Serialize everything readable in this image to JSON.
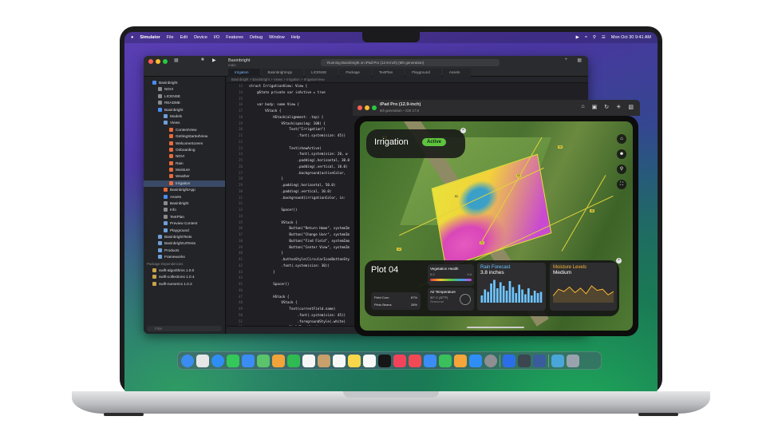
{
  "menubar": {
    "items": [
      "Simulator",
      "File",
      "Edit",
      "Device",
      "I/O",
      "Features",
      "Debug",
      "Window",
      "Help"
    ],
    "clock": "Mon Oct 30 9:41 AM"
  },
  "xcode": {
    "project": "Basinbright",
    "project_sub": "main",
    "status": "Running Basinbright on iPad Pro (12.9-inch) (6th generation)",
    "tabs": [
      "Irrigation",
      "BasinbrightApp",
      "LICENSE",
      "Package",
      "TextPlan",
      "Playground",
      "Assets"
    ],
    "nav": [
      {
        "label": "Basinbright",
        "indent": 1,
        "color": "#4a8cf0"
      },
      {
        "label": "NDVI",
        "indent": 2,
        "color": "#8a8a8a"
      },
      {
        "label": "LICENSE",
        "indent": 2,
        "color": "#8a8a8a"
      },
      {
        "label": "README",
        "indent": 2,
        "color": "#8a8a8a"
      },
      {
        "label": "Basinbright",
        "indent": 2,
        "color": "#4a8cf0"
      },
      {
        "label": "Models",
        "indent": 3,
        "color": "#6e9fd8"
      },
      {
        "label": "Views",
        "indent": 3,
        "color": "#6e9fd8"
      },
      {
        "label": "ContentView",
        "indent": 4,
        "color": "#e86a3a"
      },
      {
        "label": "GettingStartedView",
        "indent": 4,
        "color": "#e86a3a"
      },
      {
        "label": "WelcomeScreen",
        "indent": 4,
        "color": "#e86a3a"
      },
      {
        "label": "Onboarding",
        "indent": 4,
        "color": "#e86a3a"
      },
      {
        "label": "NDVI",
        "indent": 4,
        "color": "#e86a3a"
      },
      {
        "label": "Rain",
        "indent": 4,
        "color": "#e86a3a"
      },
      {
        "label": "Moisture",
        "indent": 4,
        "color": "#e86a3a"
      },
      {
        "label": "Weather",
        "indent": 4,
        "color": "#e86a3a"
      },
      {
        "label": "Irrigation",
        "indent": 4,
        "color": "#e86a3a",
        "selected": true
      },
      {
        "label": "BasinbrightApp",
        "indent": 3,
        "color": "#e86a3a"
      },
      {
        "label": "Assets",
        "indent": 3,
        "color": "#4a8cf0"
      },
      {
        "label": "Basinbright",
        "indent": 3,
        "color": "#8a8a8a"
      },
      {
        "label": "Info",
        "indent": 3,
        "color": "#8a8a8a"
      },
      {
        "label": "TestPlan",
        "indent": 3,
        "color": "#8a8a8a"
      },
      {
        "label": "Preview Content",
        "indent": 3,
        "color": "#6e9fd8"
      },
      {
        "label": "Playground",
        "indent": 3,
        "color": "#6e9fd8"
      },
      {
        "label": "BasinbrightTests",
        "indent": 2,
        "color": "#6e9fd8"
      },
      {
        "label": "BasinbrightUITests",
        "indent": 2,
        "color": "#6e9fd8"
      },
      {
        "label": "Products",
        "indent": 2,
        "color": "#6e9fd8"
      },
      {
        "label": "Frameworks",
        "indent": 2,
        "color": "#6e9fd8"
      }
    ],
    "pkg_header": "Package Dependencies",
    "packages": [
      {
        "label": "swift-algorithms 1.0.0"
      },
      {
        "label": "swift-collections 1.0.4"
      },
      {
        "label": "swift-numerics 1.0.2"
      }
    ],
    "filter": "Filter",
    "line_numbers": [
      "13",
      "14",
      "15",
      "16",
      "17",
      "18",
      "19",
      "20",
      "21",
      "22",
      "23",
      "24",
      "25",
      "26",
      "27",
      "28",
      "29",
      "30",
      "31",
      "32",
      "33",
      "34",
      "35",
      "36",
      "37",
      "38",
      "39",
      "40",
      "41",
      "42",
      "43",
      "44",
      "45",
      "46",
      "47",
      "48",
      "49",
      "50",
      "51",
      "52",
      "53",
      "54",
      "55",
      "56"
    ],
    "code": [
      "struct IrrigationView: View {",
      "    @State private var isActive = true",
      "",
      "    var body: some View {",
      "        VStack {",
      "            HStack(alignment: .top) {",
      "                VStack(spacing: 100) {",
      "                    Text(\"Irrigation\")",
      "                        .font(.system(size: 45))",
      "",
      "                    Text(showActive)",
      "                        .font(.system(size: 20, w",
      "                        .padding(.horizontal, 30.0",
      "                        .padding(.vertical, 10.0)",
      "                        .background(activeColor,",
      "                }",
      "                .padding(.horizontal, 50.0)",
      "                .padding(.vertical, 10.0)",
      "                .background(irrigationColor, in:",
      "",
      "                Spacer()",
      "",
      "                VStack {",
      "                    Button(\"Return Home\", systemIm",
      "                    Button(\"Change User\", systemIm",
      "                    Button(\"Find Field\", systemImo",
      "                    Button(\"Center View\", systemIm",
      "                }",
      "                .buttonStyle(CircularIconButtonSty",
      "                .font(.system(size: 30))",
      "            }",
      "",
      "            Spacer()",
      "",
      "            HStack {",
      "                VStack {",
      "                    Text(currentField.name)",
      "                        .font(.system(size: 45))",
      "                        .foregroundStyle(.white)",
      "                    FieldTypeView()",
      "                }",
      "                VStack {",
      "                    HealthView()",
      "                    TemperatureView()"
    ],
    "code_tail": [
      "                }",
      "                ForecastView()"
    ],
    "breadcrumb": "Basinbright > Basinbright > Views > Irrigation > IrrigationView"
  },
  "simulator": {
    "title": "iPad Pro (12.9-inch)",
    "subtitle": "6th generation – iOS 17.0"
  },
  "app": {
    "title": "Irrigation",
    "status": "Active",
    "plot": "Plot 04",
    "vegetation_label": "Vegetation Health",
    "vegetation_scale": [
      "0.2",
      "0.4"
    ],
    "field_rows": [
      {
        "label": "Field Corn",
        "value": "87%"
      },
      {
        "label": "Pinto Beans",
        "value": "28%"
      }
    ],
    "air_label": "Air Temperature",
    "air_value": "30° C (87°F)",
    "air_sub": "Seasonal",
    "rain_title": "Rain Forecast",
    "rain_value": "3.8 inches",
    "rain_bars": [
      0.3,
      0.55,
      0.45,
      0.8,
      0.95,
      0.6,
      0.85,
      0.7,
      0.5,
      0.9,
      0.65,
      0.4,
      0.75,
      0.55,
      0.35,
      0.6,
      0.3,
      0.5,
      0.4,
      0.45
    ],
    "moisture_title": "Moisture Levels",
    "moisture_value": "Medium",
    "moisture_points": [
      0.3,
      0.6,
      0.5,
      0.7,
      0.45,
      0.65,
      0.4,
      0.75,
      0.55,
      0.6,
      0.35,
      0.5
    ],
    "field_markers": [
      "32",
      "02",
      "51",
      "12",
      "48",
      "06",
      "21",
      "34"
    ],
    "colors": {
      "active": "#5ec43f",
      "rain": "#6ec5ff",
      "moisture": "#f7b733"
    }
  },
  "dock": {
    "apps": [
      {
        "name": "finder",
        "color": "#3a8cf0"
      },
      {
        "name": "launchpad",
        "color": "#e6e6e6"
      },
      {
        "name": "safari",
        "color": "#2f8ef6"
      },
      {
        "name": "messages",
        "color": "#34c759"
      },
      {
        "name": "mail",
        "color": "#3b8cf5"
      },
      {
        "name": "maps",
        "color": "#5bc36b"
      },
      {
        "name": "photos",
        "color": "#f2a33a"
      },
      {
        "name": "facetime",
        "color": "#2fba52"
      },
      {
        "name": "calendar",
        "color": "#f6f6f6"
      },
      {
        "name": "contacts",
        "color": "#c7a06b"
      },
      {
        "name": "reminders",
        "color": "#f7f7f7"
      },
      {
        "name": "notes",
        "color": "#f9d74a"
      },
      {
        "name": "freeform",
        "color": "#f7f7f7"
      },
      {
        "name": "tv",
        "color": "#161616"
      },
      {
        "name": "music",
        "color": "#f2435a"
      },
      {
        "name": "news",
        "color": "#f24a55"
      },
      {
        "name": "keynote",
        "color": "#3b8cf5"
      },
      {
        "name": "numbers",
        "color": "#39c05a"
      },
      {
        "name": "pages",
        "color": "#f6a53a"
      },
      {
        "name": "app-store",
        "color": "#2f8ef6"
      },
      {
        "name": "settings",
        "color": "#8e8e93"
      },
      {
        "name": "xcode",
        "color": "#2b6ee8"
      },
      {
        "name": "instruments",
        "color": "#3b4650"
      },
      {
        "name": "simulator",
        "color": "#3a5c9c"
      },
      {
        "name": "downloads",
        "color": "#4aa6d8"
      },
      {
        "name": "trash",
        "color": "#9aa3ad"
      }
    ],
    "separators_after": [
      20,
      23
    ]
  }
}
